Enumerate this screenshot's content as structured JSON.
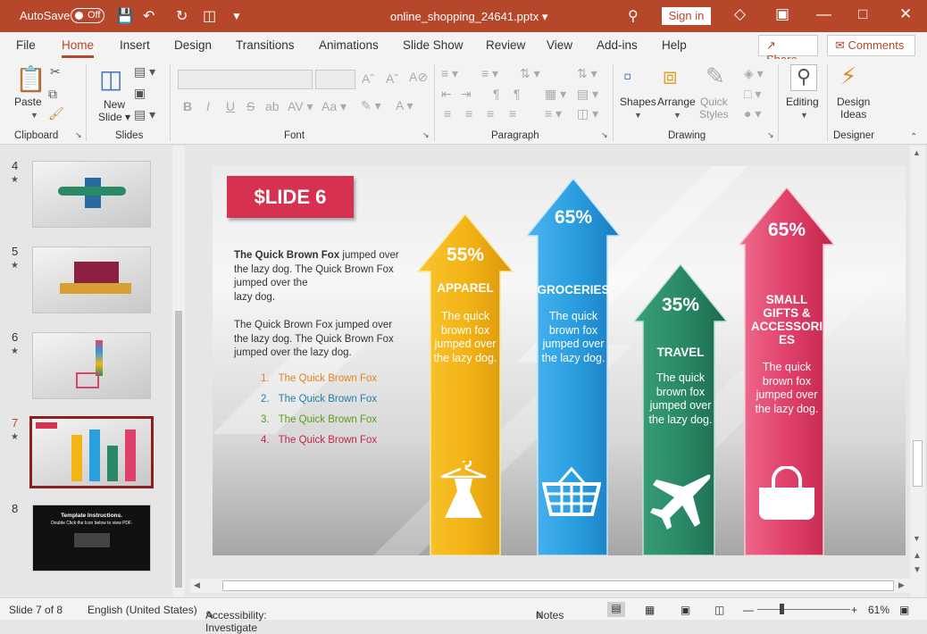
{
  "titlebar": {
    "autosave_label": "AutoSave",
    "autosave_state": "Off",
    "document_name": "online_shopping_24641.pptx",
    "sign_in": "Sign in"
  },
  "tabs": [
    "File",
    "Home",
    "Insert",
    "Design",
    "Transitions",
    "Animations",
    "Slide Show",
    "Review",
    "View",
    "Add-ins",
    "Help"
  ],
  "active_tab": "Home",
  "share_label": "Share",
  "comments_label": "Comments",
  "ribbon": {
    "paste": "Paste",
    "new_slide_1": "New",
    "new_slide_2": "Slide",
    "shapes": "Shapes",
    "arrange": "Arrange",
    "quick_styles_1": "Quick",
    "quick_styles_2": "Styles",
    "editing": "Editing",
    "design_ideas_1": "Design",
    "design_ideas_2": "Ideas",
    "groups": {
      "clipboard": "Clipboard",
      "slides": "Slides",
      "font": "Font",
      "paragraph": "Paragraph",
      "drawing": "Drawing",
      "designer": "Designer"
    }
  },
  "thumbnails": [
    {
      "number": "4",
      "selected": false
    },
    {
      "number": "5",
      "selected": false
    },
    {
      "number": "6",
      "selected": false
    },
    {
      "number": "7",
      "selected": true
    },
    {
      "number": "8",
      "selected": false,
      "line1": "Template Instructions.",
      "line2": "Double Click the Icon below to view PDF."
    }
  ],
  "slide": {
    "title": "$LIDE 6",
    "para1_bold": "The Quick Brown Fox",
    "para1_rest": " jumped over the lazy dog. The Quick Brown Fox jumped over the",
    "para1_end": "lazy dog.",
    "para2": "The Quick Brown Fox jumped over the lazy dog. The Quick Brown Fox jumped over the lazy dog.",
    "list": [
      {
        "num": "1.",
        "text": "The Quick Brown Fox",
        "color": "#e0851c"
      },
      {
        "num": "2.",
        "text": "The Quick Brown Fox",
        "color": "#1f7fa8"
      },
      {
        "num": "3.",
        "text": "The Quick Brown Fox",
        "color": "#5d9c1c"
      },
      {
        "num": "4.",
        "text": "The Quick Brown Fox",
        "color": "#c0264a"
      }
    ],
    "arrows": [
      {
        "pct": "55%",
        "category": "APPAREL",
        "desc": "The quick brown fox jumped over the lazy dog.",
        "color": "#f3b416",
        "icon": "dress-icon"
      },
      {
        "pct": "65%",
        "category": "GROCERIES",
        "desc": "The quick brown fox jumped over the lazy dog.",
        "color": "#2a9fe0",
        "icon": "basket-icon"
      },
      {
        "pct": "35%",
        "category": "TRAVEL",
        "desc": "The quick brown fox jumped over the lazy dog.",
        "color": "#2a8a66",
        "icon": "airplane-icon"
      },
      {
        "pct": "65%",
        "category_1": "SMALL",
        "category_2": "GIFTS &",
        "category_3": "ACCESSORI",
        "category_4": "ES",
        "desc": "The quick brown fox jumped over the lazy dog.",
        "color": "#e0416a",
        "icon": "bag-icon"
      }
    ]
  },
  "status": {
    "slide_of": "Slide 7 of 8",
    "language": "English (United States)",
    "accessibility": "Accessibility: Investigate",
    "notes": "Notes",
    "zoom": "61%"
  }
}
